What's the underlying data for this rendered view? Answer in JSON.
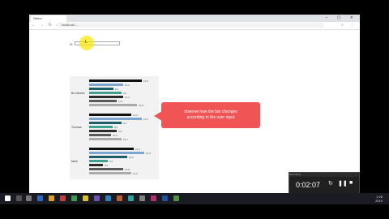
{
  "browser": {
    "tab_title": "Demo",
    "url": "localhost:...",
    "nav_icons": "← → ↻ ⌂",
    "ext_icons": "☆ ⋮",
    "window_controls": "– ▢ ✕"
  },
  "page": {
    "input_label": "N:",
    "input_value": "",
    "cursor_mark": "L"
  },
  "chart": {
    "groups": [
      {
        "label": "Bo Nicoles",
        "bars": [
          {
            "value": "12.5",
            "color": "#111111",
            "pct": 0.86
          },
          {
            "value": "10.2",
            "color": "#7aa6d0",
            "pct": 0.55
          },
          {
            "value": "8.4",
            "color": "#1e5e6b",
            "pct": 0.4
          },
          {
            "value": "9.6",
            "color": "#3fa291",
            "pct": 0.52
          },
          {
            "value": "10.4",
            "color": "#2b2b2b",
            "pct": 0.55
          },
          {
            "value": "11.1",
            "color": "#5a5a5a",
            "pct": 0.45
          },
          {
            "value": "13.8",
            "color": "#aaaaaa",
            "pct": 0.78
          }
        ]
      },
      {
        "label": "Thomas",
        "bars": [
          {
            "value": "12.2",
            "color": "#111111",
            "pct": 0.68
          },
          {
            "value": "14.0",
            "color": "#7aa6d0",
            "pct": 0.85
          },
          {
            "value": "9.1",
            "color": "#1e5e6b",
            "pct": 0.52
          },
          {
            "value": "8.5",
            "color": "#3fa291",
            "pct": 0.38
          },
          {
            "value": "9.0",
            "color": "#2b2b2b",
            "pct": 0.45
          },
          {
            "value": "10.6",
            "color": "#5a5a5a",
            "pct": 0.35
          },
          {
            "value": "12.7",
            "color": "#aaaaaa",
            "pct": 0.52
          }
        ]
      },
      {
        "label": "Mark",
        "bars": [
          {
            "value": "11.2",
            "color": "#111111",
            "pct": 0.72
          },
          {
            "value": "12.4",
            "color": "#7aa6d0",
            "pct": 0.9
          },
          {
            "value": "10.0",
            "color": "#1e5e6b",
            "pct": 0.62
          },
          {
            "value": "8.0",
            "color": "#3fa291",
            "pct": 0.3
          },
          {
            "value": "9.5",
            "color": "#2b2b2b",
            "pct": 0.22
          },
          {
            "value": "10.8",
            "color": "#5a5a5a",
            "pct": 0.55
          },
          {
            "value": "12.0",
            "color": "#aaaaaa",
            "pct": 0.68
          }
        ]
      }
    ]
  },
  "callout": {
    "line1": "observe how the bar changes",
    "line2": "according to the user input"
  },
  "recorder": {
    "title": "Recording",
    "time": "0:02:07",
    "btn_rotate": "↻",
    "btn_pause": "❚❚",
    "btn_stop": "■"
  },
  "taskbar": {
    "time": "1:28",
    "date": "2019"
  }
}
